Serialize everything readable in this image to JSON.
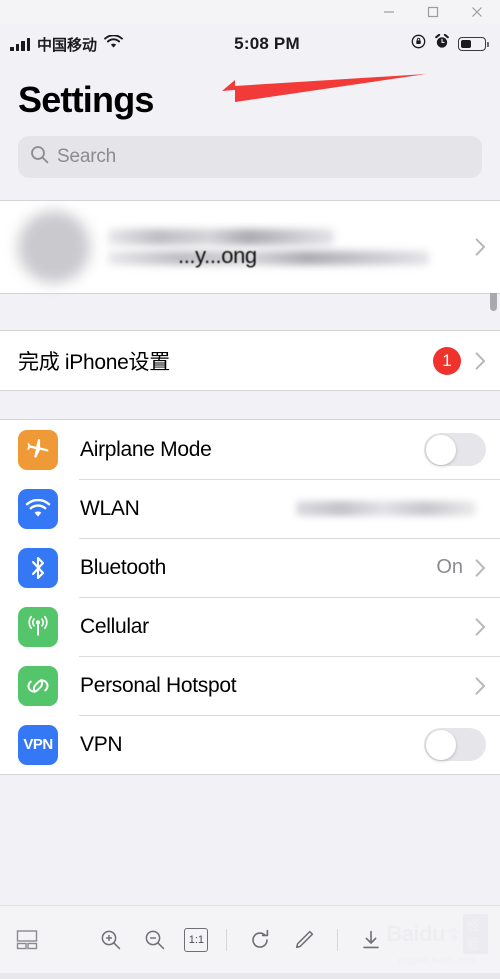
{
  "window": {
    "minimize_label": "Minimize",
    "maximize_label": "Maximize",
    "close_label": "Close"
  },
  "statusbar": {
    "carrier": "中国移动",
    "time": "5:08 PM",
    "signal_icon": "signal-bars-icon",
    "wifi_icon": "wifi-icon",
    "rotation_lock_icon": "rotation-lock-icon",
    "alarm_icon": "alarm-clock-icon",
    "battery_icon": "battery-icon",
    "battery_level_percent": 45
  },
  "header": {
    "title": "Settings"
  },
  "search": {
    "placeholder": "Search",
    "value": "",
    "icon": "search-icon"
  },
  "annotation": {
    "type": "arrow",
    "color": "#f23b38",
    "direction": "left",
    "points_to": "Settings"
  },
  "profile": {
    "name_redacted": "...y...ong",
    "subtitle_redacted": true,
    "avatar": "user-avatar",
    "chevron": "chevron-right-icon"
  },
  "setup": {
    "label": "完成 iPhone设置",
    "badge_count": "1",
    "badge_color": "#f0322c",
    "chevron": "chevron-right-icon"
  },
  "settings_rows": [
    {
      "label": "Airplane Mode",
      "icon": "airplane-icon",
      "icon_color": "#f09a37",
      "control": "toggle",
      "toggle_on": false,
      "value": ""
    },
    {
      "label": "WLAN",
      "icon": "wifi-icon",
      "icon_color": "#3478f6",
      "control": "redacted-value",
      "value": ""
    },
    {
      "label": "Bluetooth",
      "icon": "bluetooth-icon",
      "icon_color": "#3478f6",
      "control": "value-chevron",
      "value": "On"
    },
    {
      "label": "Cellular",
      "icon": "cellular-antenna-icon",
      "icon_color": "#54c56a",
      "control": "chevron",
      "value": ""
    },
    {
      "label": "Personal Hotspot",
      "icon": "hotspot-link-icon",
      "icon_color": "#54c56a",
      "control": "chevron",
      "value": ""
    },
    {
      "label": "VPN",
      "icon": "vpn-icon",
      "icon_color": "#3478f6",
      "icon_text": "VPN",
      "control": "toggle",
      "toggle_on": false,
      "value": ""
    }
  ],
  "toolbar": {
    "layout_icon": "split-screen-icon",
    "zoom_in_icon": "zoom-in-icon",
    "zoom_out_icon": "zoom-out-icon",
    "actual_size_label": "1:1",
    "rotate_icon": "rotate-icon",
    "edit_icon": "pencil-icon",
    "download_icon": "download-icon"
  },
  "watermark": {
    "brand": "Baidu",
    "suffix": "经验",
    "url": "jingyan.baidu.com",
    "paw_icon": "paw-icon"
  }
}
